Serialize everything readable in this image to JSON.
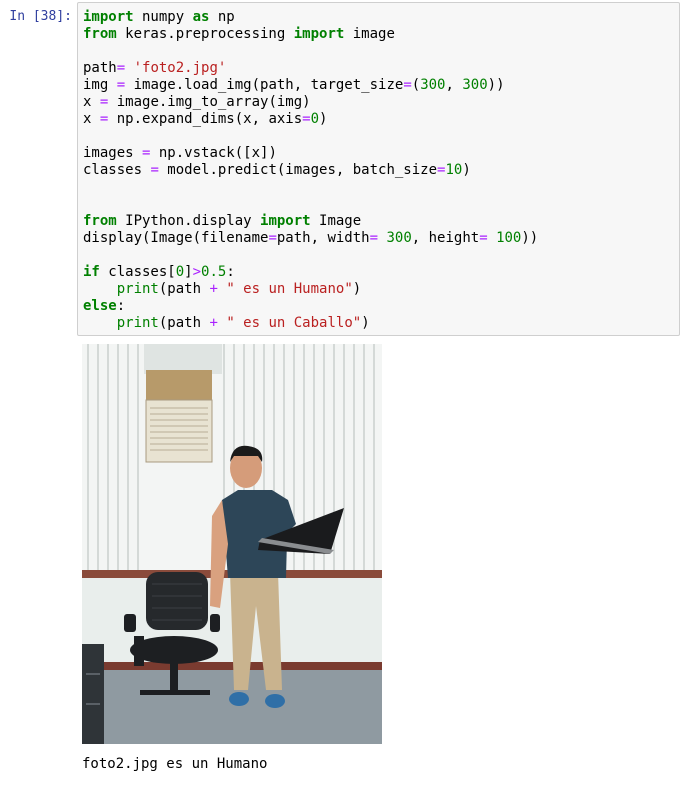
{
  "cell": {
    "prompt": "In [38]:",
    "code_lines": [
      [
        {
          "t": "import",
          "c": "kw"
        },
        {
          "t": " numpy ",
          "c": ""
        },
        {
          "t": "as",
          "c": "kw"
        },
        {
          "t": " np",
          "c": ""
        }
      ],
      [
        {
          "t": "from",
          "c": "kw"
        },
        {
          "t": " keras.preprocessing ",
          "c": ""
        },
        {
          "t": "import",
          "c": "kw"
        },
        {
          "t": " image",
          "c": ""
        }
      ],
      [],
      [
        {
          "t": "path",
          "c": ""
        },
        {
          "t": "=",
          "c": "op"
        },
        {
          "t": " ",
          "c": ""
        },
        {
          "t": "'foto2.jpg'",
          "c": "str"
        }
      ],
      [
        {
          "t": "img ",
          "c": ""
        },
        {
          "t": "=",
          "c": "op"
        },
        {
          "t": " image.load_img(path, target_size",
          "c": ""
        },
        {
          "t": "=",
          "c": "op"
        },
        {
          "t": "(",
          "c": ""
        },
        {
          "t": "300",
          "c": "num"
        },
        {
          "t": ", ",
          "c": ""
        },
        {
          "t": "300",
          "c": "num"
        },
        {
          "t": "))",
          "c": ""
        }
      ],
      [
        {
          "t": "x ",
          "c": ""
        },
        {
          "t": "=",
          "c": "op"
        },
        {
          "t": " image.img_to_array(img)",
          "c": ""
        }
      ],
      [
        {
          "t": "x ",
          "c": ""
        },
        {
          "t": "=",
          "c": "op"
        },
        {
          "t": " np.expand_dims(x, axis",
          "c": ""
        },
        {
          "t": "=",
          "c": "op"
        },
        {
          "t": "0",
          "c": "num"
        },
        {
          "t": ")",
          "c": ""
        }
      ],
      [],
      [
        {
          "t": "images ",
          "c": ""
        },
        {
          "t": "=",
          "c": "op"
        },
        {
          "t": " np.vstack([x])",
          "c": ""
        }
      ],
      [
        {
          "t": "classes ",
          "c": ""
        },
        {
          "t": "=",
          "c": "op"
        },
        {
          "t": " model.predict(images, batch_size",
          "c": ""
        },
        {
          "t": "=",
          "c": "op"
        },
        {
          "t": "10",
          "c": "num"
        },
        {
          "t": ")",
          "c": ""
        }
      ],
      [],
      [],
      [
        {
          "t": "from",
          "c": "kw"
        },
        {
          "t": " IPython.display ",
          "c": ""
        },
        {
          "t": "import",
          "c": "kw"
        },
        {
          "t": " Image",
          "c": ""
        }
      ],
      [
        {
          "t": "display(Image(filename",
          "c": ""
        },
        {
          "t": "=",
          "c": "op"
        },
        {
          "t": "path, width",
          "c": ""
        },
        {
          "t": "=",
          "c": "op"
        },
        {
          "t": " ",
          "c": ""
        },
        {
          "t": "300",
          "c": "num"
        },
        {
          "t": ", height",
          "c": ""
        },
        {
          "t": "=",
          "c": "op"
        },
        {
          "t": " ",
          "c": ""
        },
        {
          "t": "100",
          "c": "num"
        },
        {
          "t": "))",
          "c": ""
        }
      ],
      [],
      [
        {
          "t": "if",
          "c": "kw"
        },
        {
          "t": " classes[",
          "c": ""
        },
        {
          "t": "0",
          "c": "num"
        },
        {
          "t": "]",
          "c": ""
        },
        {
          "t": ">",
          "c": "op"
        },
        {
          "t": "0.5",
          "c": "num"
        },
        {
          "t": ":",
          "c": ""
        }
      ],
      [
        {
          "t": "    ",
          "c": ""
        },
        {
          "t": "print",
          "c": "bi"
        },
        {
          "t": "(path ",
          "c": ""
        },
        {
          "t": "+",
          "c": "op"
        },
        {
          "t": " ",
          "c": ""
        },
        {
          "t": "\" es un Humano\"",
          "c": "str"
        },
        {
          "t": ")",
          "c": ""
        }
      ],
      [
        {
          "t": "else",
          "c": "kw"
        },
        {
          "t": ":",
          "c": ""
        }
      ],
      [
        {
          "t": "    ",
          "c": ""
        },
        {
          "t": "print",
          "c": "bi"
        },
        {
          "t": "(path ",
          "c": ""
        },
        {
          "t": "+",
          "c": "op"
        },
        {
          "t": " ",
          "c": ""
        },
        {
          "t": "\" es un Caballo\"",
          "c": "str"
        },
        {
          "t": ")",
          "c": ""
        }
      ]
    ]
  },
  "output": {
    "image_alt_semantic": "photo-man-with-laptop-and-chair",
    "text": "foto2.jpg es un Humano"
  },
  "colors": {
    "keyword": "#008000",
    "operator": "#aa22ff",
    "string": "#ba2121",
    "number": "#008000",
    "prompt": "#303f9f",
    "cell_bg": "#f7f7f7",
    "cell_border": "#cfcfcf"
  }
}
